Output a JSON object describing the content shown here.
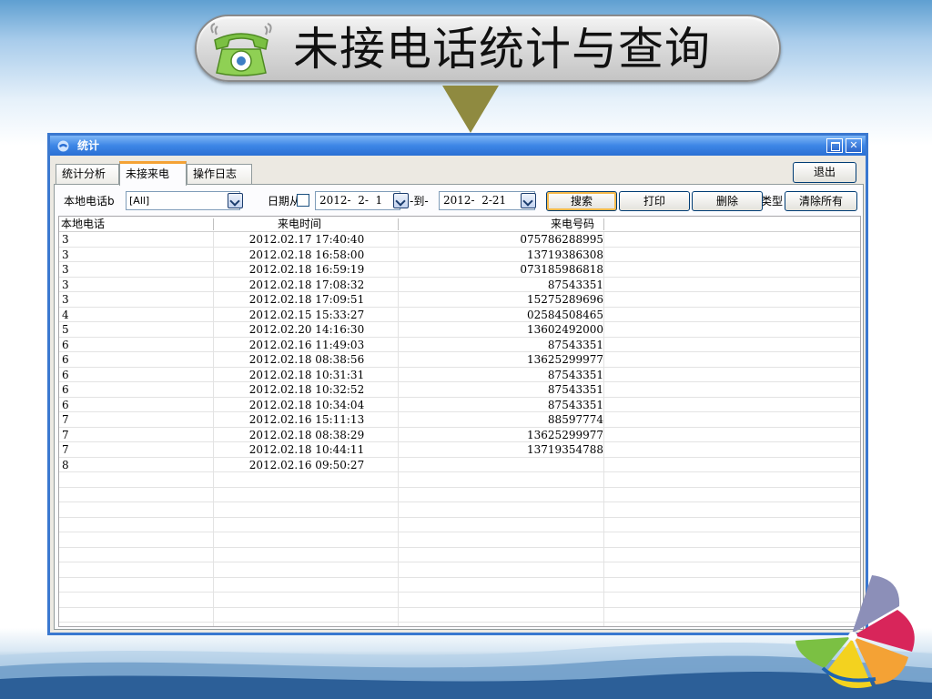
{
  "slide": {
    "title": "未接电话统计与查询"
  },
  "window": {
    "title": "统计",
    "tabs": [
      {
        "label": "统计分析"
      },
      {
        "label": "未接来电"
      },
      {
        "label": "操作日志"
      }
    ],
    "exit_label": "退出"
  },
  "filters": {
    "local_phone_label": "本地电话",
    "local_phone_label_clipped": "本地电话b",
    "local_phone_value": "[All]",
    "date_from_label": "日期从",
    "date_from_value": "2012-  2-  1",
    "to_label": "-到-",
    "date_to_value": "2012-  2-21",
    "search_label": "搜索",
    "print_label": "打印",
    "delete_label": "删除",
    "type_label_clipped": "类型",
    "clear_all_label": "清除所有"
  },
  "table": {
    "columns": [
      "本地电话",
      "来电时间",
      "来电号码"
    ],
    "rows": [
      [
        "3",
        "2012.02.17 17:40:40",
        "075786288995"
      ],
      [
        "3",
        "2012.02.18 16:58:00",
        "13719386308"
      ],
      [
        "3",
        "2012.02.18 16:59:19",
        "073185986818"
      ],
      [
        "3",
        "2012.02.18 17:08:32",
        "87543351"
      ],
      [
        "3",
        "2012.02.18 17:09:51",
        "15275289696"
      ],
      [
        "4",
        "2012.02.15 15:33:27",
        "02584508465"
      ],
      [
        "5",
        "2012.02.20 14:16:30",
        "13602492000"
      ],
      [
        "6",
        "2012.02.16 11:49:03",
        "87543351"
      ],
      [
        "6",
        "2012.02.18 08:38:56",
        "13625299977"
      ],
      [
        "6",
        "2012.02.18 10:31:31",
        "87543351"
      ],
      [
        "6",
        "2012.02.18 10:32:52",
        "87543351"
      ],
      [
        "6",
        "2012.02.18 10:34:04",
        "87543351"
      ],
      [
        "7",
        "2012.02.16 15:11:13",
        "88597774"
      ],
      [
        "7",
        "2012.02.18 08:38:29",
        "13625299977"
      ],
      [
        "7",
        "2012.02.18 10:44:11",
        "13719354788"
      ],
      [
        "8",
        "2012.02.16 09:50:27",
        ""
      ],
      [
        "",
        "",
        ""
      ],
      [
        "",
        "",
        ""
      ],
      [
        "",
        "",
        ""
      ],
      [
        "",
        "",
        ""
      ],
      [
        "",
        "",
        ""
      ],
      [
        "",
        "",
        ""
      ],
      [
        "",
        "",
        ""
      ],
      [
        "",
        "",
        ""
      ],
      [
        "",
        "",
        ""
      ],
      [
        "",
        "",
        ""
      ]
    ]
  },
  "icons": {
    "phone": "phone-icon",
    "arrow": "down-arrow-icon",
    "logo": "pinwheel-logo-icon"
  },
  "colors": {
    "window_border": "#3a78d0",
    "titlebar": "#2a6fd4",
    "arrow": "#8f8a40",
    "phone_green": "#7bc043",
    "tab_highlight": "#f4a235"
  }
}
